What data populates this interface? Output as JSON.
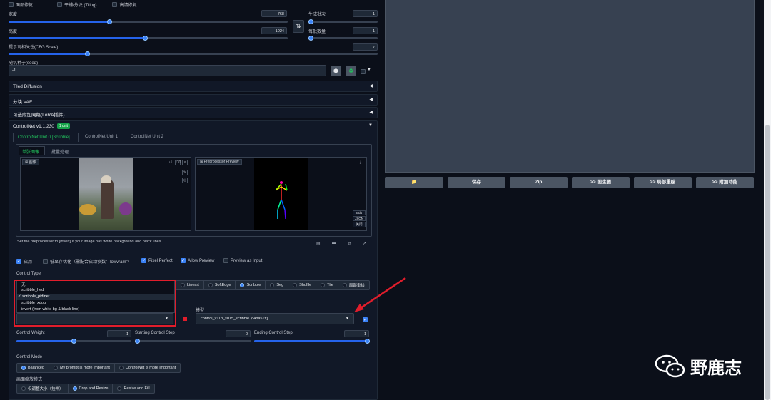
{
  "top_checks": [
    {
      "label": "面部修复",
      "checked": false
    },
    {
      "label": "平铺/分块 (Tiling)",
      "checked": false
    },
    {
      "label": "高清修复",
      "checked": false
    }
  ],
  "width": {
    "label": "宽度",
    "value": "768"
  },
  "height": {
    "label": "高度",
    "value": "1024"
  },
  "batch_count": {
    "label": "生成批次",
    "value": "1"
  },
  "batch_size": {
    "label": "每批数量",
    "value": "1"
  },
  "cfg": {
    "label": "提示词相关性(CFG Scale)",
    "value": "7"
  },
  "seed": {
    "label": "随机种子(seed)",
    "value": "-1"
  },
  "swap_icon": "swap-icon",
  "accordions": [
    {
      "label": "Tiled Diffusion"
    },
    {
      "label": "分块 VAE"
    },
    {
      "label": "可选附加网络(LoRA插件)"
    }
  ],
  "controlnet": {
    "title": "ControlNet v1.1.230",
    "badge": "1 unit",
    "units": [
      "ControlNet Unit 0 [Scribble]",
      "ControlNet Unit 1",
      "ControlNet Unit 2"
    ],
    "subtabs": [
      "单张图像",
      "批量处理"
    ],
    "image_label": "图像",
    "preview_label": "Preprocessor Preview",
    "preview_buttons": [
      "Edit",
      "JSON",
      "关闭"
    ],
    "hint": "Set the preprocessor to [invert] If your image has white background and black lines.",
    "options": [
      {
        "label": "启用",
        "checked": true
      },
      {
        "label": "低显存优化（需配合启动参数\"--lowvram\"）",
        "checked": false
      },
      {
        "label": "Pixel Perfect",
        "checked": true
      },
      {
        "label": "Allow Preview",
        "checked": true
      },
      {
        "label": "Preview as Input",
        "checked": false
      }
    ],
    "control_type_label": "Control Type",
    "control_types": [
      "Lineart",
      "SoftEdge",
      "Scribble",
      "Seg",
      "Shuffle",
      "Tile",
      "局部重绘"
    ],
    "selected_type": "Scribble",
    "preprocessor_options": [
      "无",
      "scribble_hed",
      "scribble_pidinet",
      "scribble_xdog",
      "invert (from white bg & black line)"
    ],
    "selected_preprocessor": "scribble_pidinet",
    "model_label": "模型",
    "model_value": "control_v11p_sd15_scribble [d4ba51ff]",
    "control_weight": {
      "label": "Control Weight",
      "value": "1",
      "fraction": 0.5
    },
    "start_step": {
      "label": "Starting Control Step",
      "value": "0",
      "fraction": 0.0
    },
    "end_step": {
      "label": "Ending Control Step",
      "value": "1",
      "fraction": 1.0
    },
    "control_mode_label": "Control Mode",
    "control_modes": [
      "Balanced",
      "My prompt is more important",
      "ControlNet is more important"
    ],
    "selected_mode": "Balanced",
    "resize_label": "画面缩放模式",
    "resize_modes": [
      "仅调整大小（拉伸）",
      "Crop and Resize",
      "Resize and Fill"
    ],
    "selected_resize": "Crop and Resize"
  },
  "output_buttons": [
    "📁",
    "保存",
    "Zip",
    ">> 图生图",
    ">> 局部重绘",
    ">> 附加功能"
  ],
  "watermark": "野鹿志",
  "colors": {
    "accent": "#3b82f6",
    "annotation": "#e11d2b",
    "bg": "#0b0f19"
  }
}
